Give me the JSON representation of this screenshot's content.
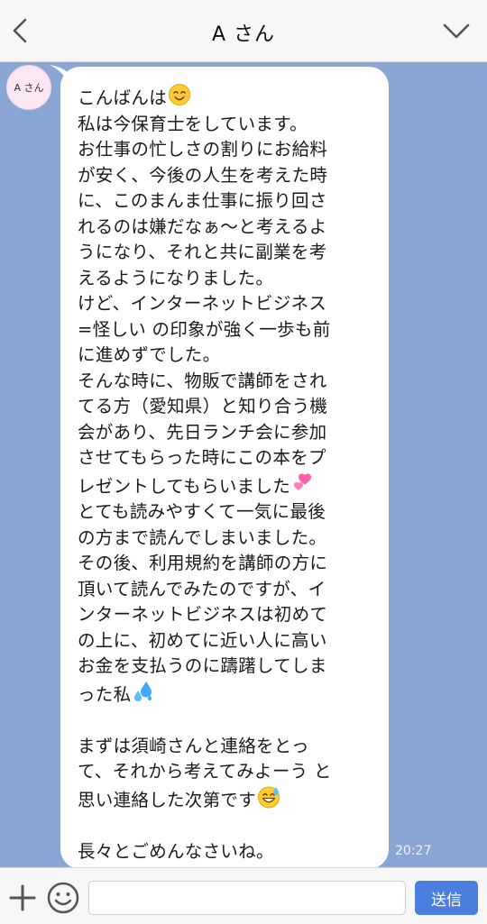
{
  "header": {
    "title": "A さん",
    "back_icon": "chevron-left-icon",
    "menu_icon": "chevron-down-icon"
  },
  "chat": {
    "avatar_label": "A さん",
    "message_lines": [
      {
        "text": "こんばんは",
        "emoji": "smiling-face-emoji"
      },
      {
        "text": "私は今保育士をしています。"
      },
      {
        "text": "お仕事の忙しさの割りにお給料"
      },
      {
        "text": "が安く、今後の人生を考えた時"
      },
      {
        "text": "に、このまんま仕事に振り回さ"
      },
      {
        "text": "れるのは嫌だなぁ〜と考えるよ"
      },
      {
        "text": "うになり、それと共に副業を考"
      },
      {
        "text": "えるようになりました。"
      },
      {
        "text": "けど、インターネットビジネス"
      },
      {
        "text": "=怪しい の印象が強く一歩も前"
      },
      {
        "text": "に進めずでした。"
      },
      {
        "text": "そんな時に、物販で講師をされ"
      },
      {
        "text": "てる方（愛知県）と知り合う機"
      },
      {
        "text": "会があり、先日ランチ会に参加"
      },
      {
        "text": "させてもらった時にこの本をプ"
      },
      {
        "text": "レゼントしてもらいました",
        "emoji": "two-hearts-emoji"
      },
      {
        "text": "とても読みやすくて一気に最後"
      },
      {
        "text": "の方まで読んでしまいました。"
      },
      {
        "text": "その後、利用規約を講師の方に"
      },
      {
        "text": "頂いて読んでみたのですが、イ"
      },
      {
        "text": "ンターネットビジネスは初めて"
      },
      {
        "text": "の上に、初めてに近い人に高い"
      },
      {
        "text": "お金を支払うのに躊躇してしま"
      },
      {
        "text": "った私",
        "emoji": "sweat-droplets-emoji"
      },
      {
        "text": ""
      },
      {
        "text": "まずは須崎さんと連絡をとっ"
      },
      {
        "text": "て、それから考えてみよーう と"
      },
      {
        "text": "思い連絡した次第です",
        "emoji": "grinning-sweat-emoji"
      },
      {
        "text": ""
      },
      {
        "text": "長々とごめんなさいね。"
      }
    ],
    "timestamp": "20:27"
  },
  "input_bar": {
    "plus_icon": "plus-icon",
    "sticker_icon": "smile-icon",
    "placeholder": "",
    "send_label": "送信"
  },
  "colors": {
    "background": "#8aa6d4",
    "header": "#f7f7f8",
    "send_button": "#4a7fe0",
    "avatar": "#fbe6f3"
  }
}
